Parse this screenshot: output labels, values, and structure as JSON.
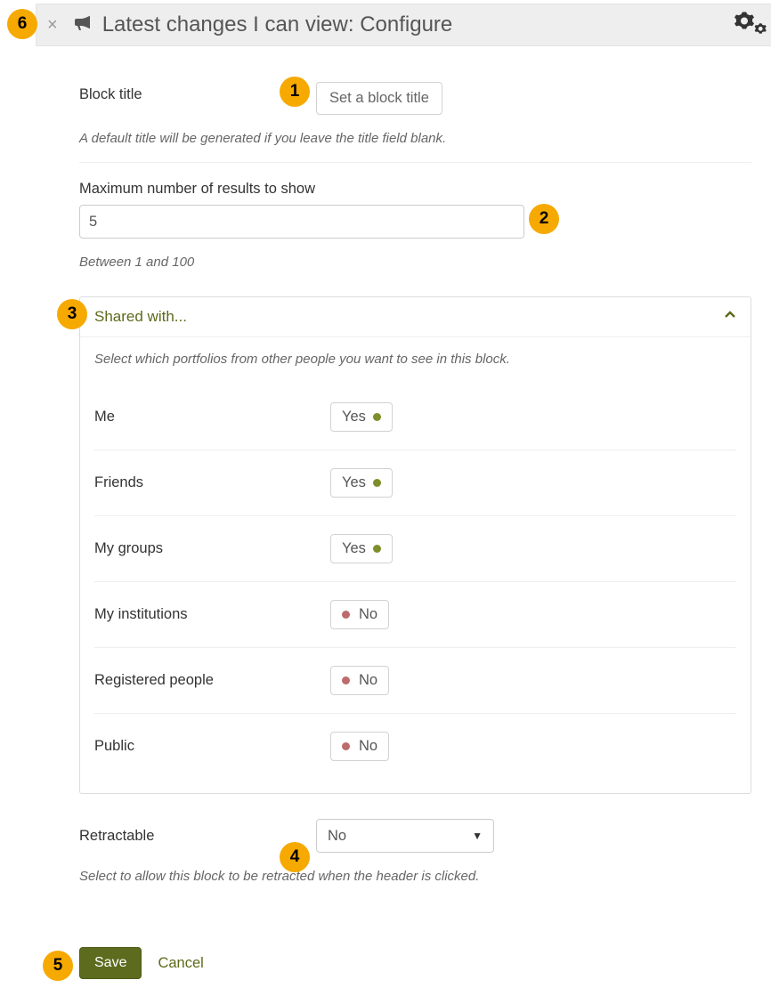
{
  "header": {
    "title": "Latest changes I can view: Configure"
  },
  "form": {
    "block_title_label": "Block title",
    "block_title_button": "Set a block title",
    "block_title_hint": "A default title will be generated if you leave the title field blank.",
    "max_results_label": "Maximum number of results to show",
    "max_results_value": "5",
    "max_results_hint": "Between 1 and 100"
  },
  "shared": {
    "panel_title": "Shared with...",
    "panel_hint": "Select which portfolios from other people you want to see in this block.",
    "options": [
      {
        "label": "Me",
        "value": "Yes",
        "on": true
      },
      {
        "label": "Friends",
        "value": "Yes",
        "on": true
      },
      {
        "label": "My groups",
        "value": "Yes",
        "on": true
      },
      {
        "label": "My institutions",
        "value": "No",
        "on": false
      },
      {
        "label": "Registered people",
        "value": "No",
        "on": false
      },
      {
        "label": "Public",
        "value": "No",
        "on": false
      }
    ]
  },
  "retractable": {
    "label": "Retractable",
    "value": "No",
    "hint": "Select to allow this block to be retracted when the header is clicked."
  },
  "actions": {
    "save": "Save",
    "cancel": "Cancel"
  },
  "badges": {
    "b1": "1",
    "b2": "2",
    "b3": "3",
    "b4": "4",
    "b5": "5",
    "b6": "6"
  }
}
